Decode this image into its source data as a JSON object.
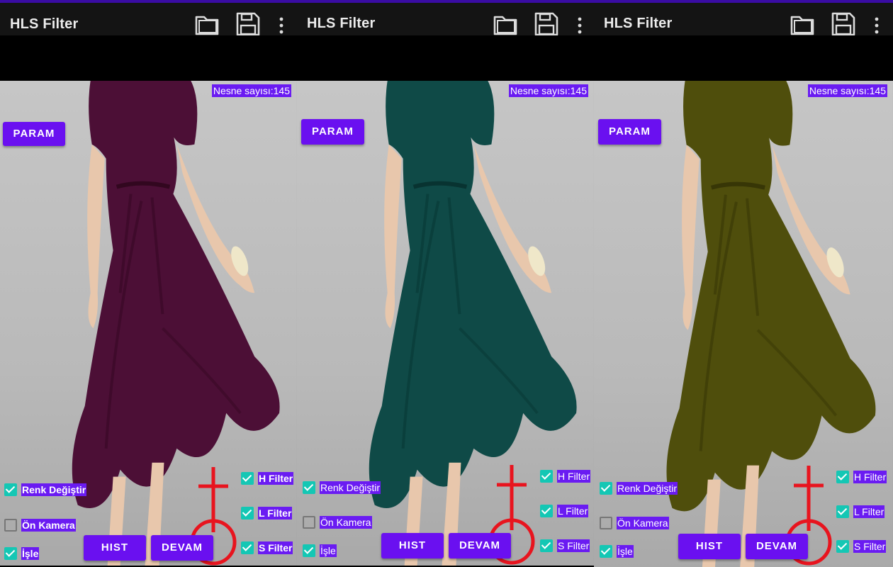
{
  "app": {
    "title": "HLS Filter",
    "icons": [
      "folder-icon",
      "save-icon",
      "overflow-menu-icon"
    ]
  },
  "overlay": {
    "count_label": "Nesne sayısı:145",
    "param_button": "PARAM",
    "hist_button": "HIST",
    "devam_button": "DEVAM",
    "left_checks": [
      {
        "label": "Renk Değiştir",
        "checked": true
      },
      {
        "label": "Ön Kamera",
        "checked": false
      },
      {
        "label": "İşle",
        "checked": true
      }
    ],
    "right_checks": [
      {
        "label": "H Filter",
        "checked": true
      },
      {
        "label": "L Filter",
        "checked": true
      },
      {
        "label": "S Filter",
        "checked": true
      }
    ]
  },
  "panels": [
    {
      "dress_color": "#4c0f36"
    },
    {
      "dress_color": "#0f4a47"
    },
    {
      "dress_color": "#4f4e0c"
    }
  ],
  "colors": {
    "accent": "#6a10f0",
    "checkbox": "#14c7b4",
    "marker": "#e8141e"
  }
}
